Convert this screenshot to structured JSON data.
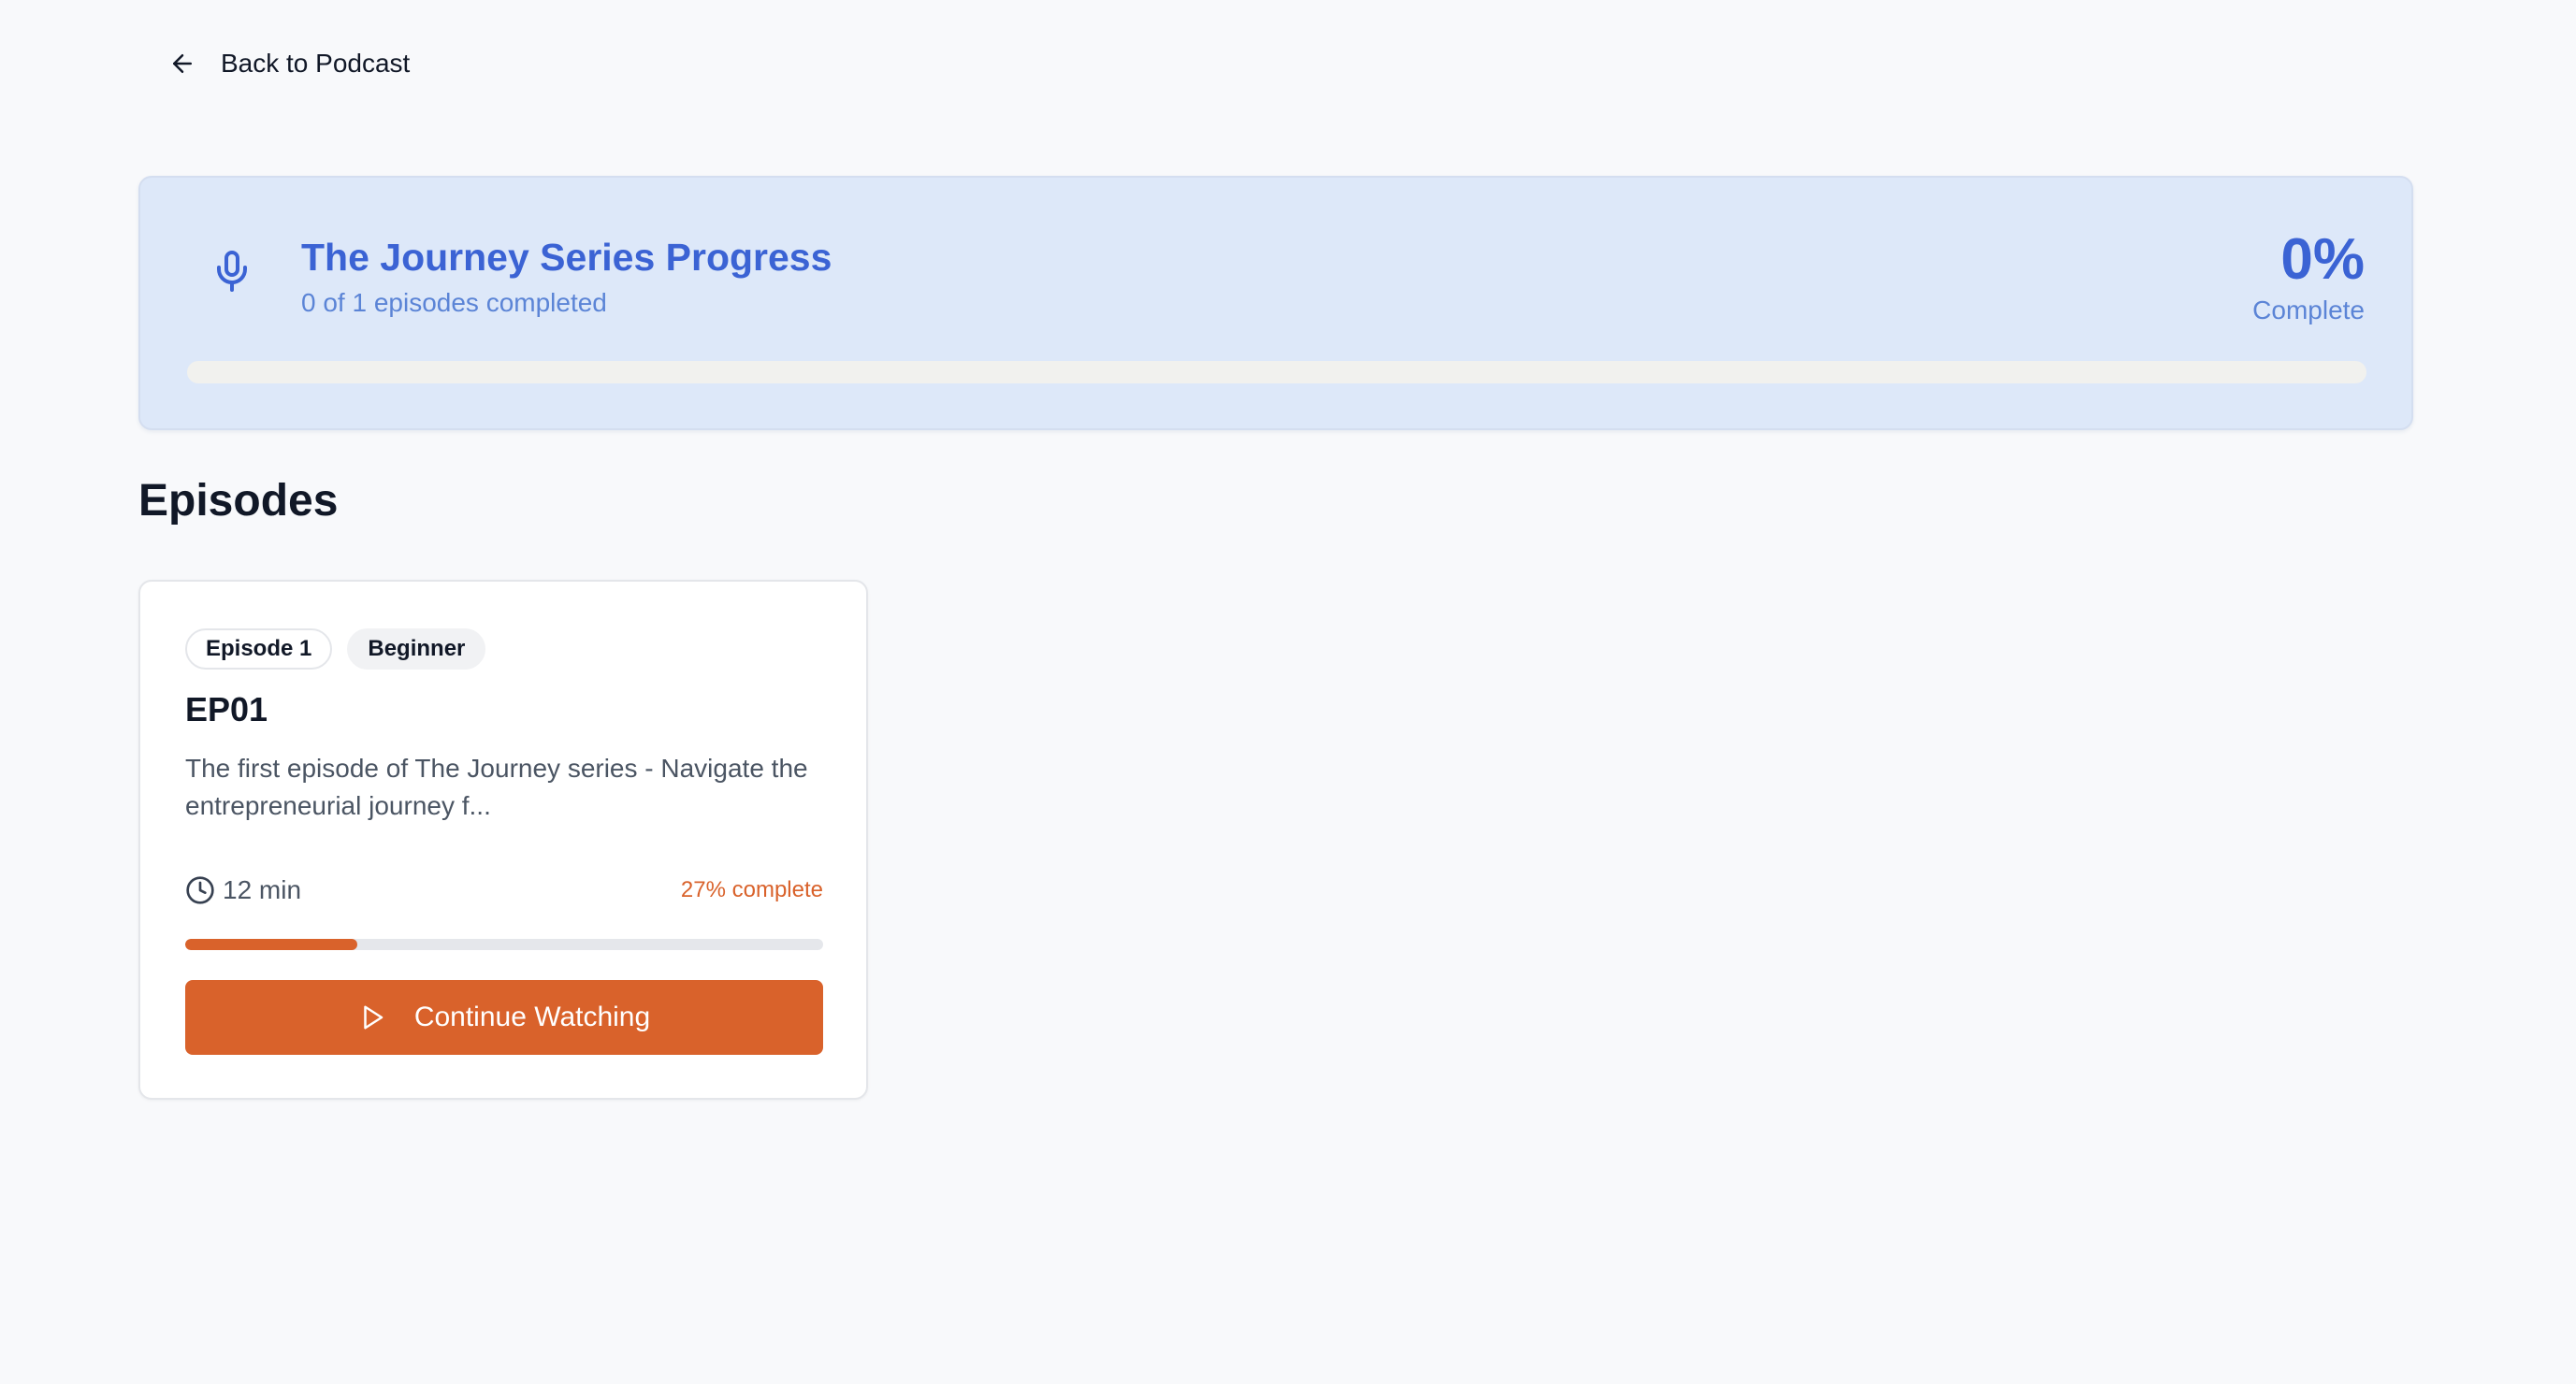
{
  "nav": {
    "back_label": "Back to Podcast",
    "back_icon": "arrow-left-icon"
  },
  "series_progress": {
    "icon": "microphone-icon",
    "title": "The Journey Series Progress",
    "subtitle": "0 of 1 episodes completed",
    "percent_label": "0%",
    "percent_caption": "Complete",
    "progress_fraction": 0,
    "accent_color": "#3b63d4",
    "background_color": "#dde8f9"
  },
  "episodes_section": {
    "heading": "Episodes"
  },
  "episodes": [
    {
      "badge_number": "Episode 1",
      "badge_level": "Beginner",
      "title": "EP01",
      "description": "The first episode of The Journey series - Navigate the entrepreneurial journey f...",
      "duration": "12 min",
      "duration_icon": "clock-icon",
      "complete_label": "27% complete",
      "progress_fraction": 0.27,
      "button_label": "Continue Watching",
      "button_icon": "play-icon",
      "accent_color": "#d9622b"
    }
  ]
}
